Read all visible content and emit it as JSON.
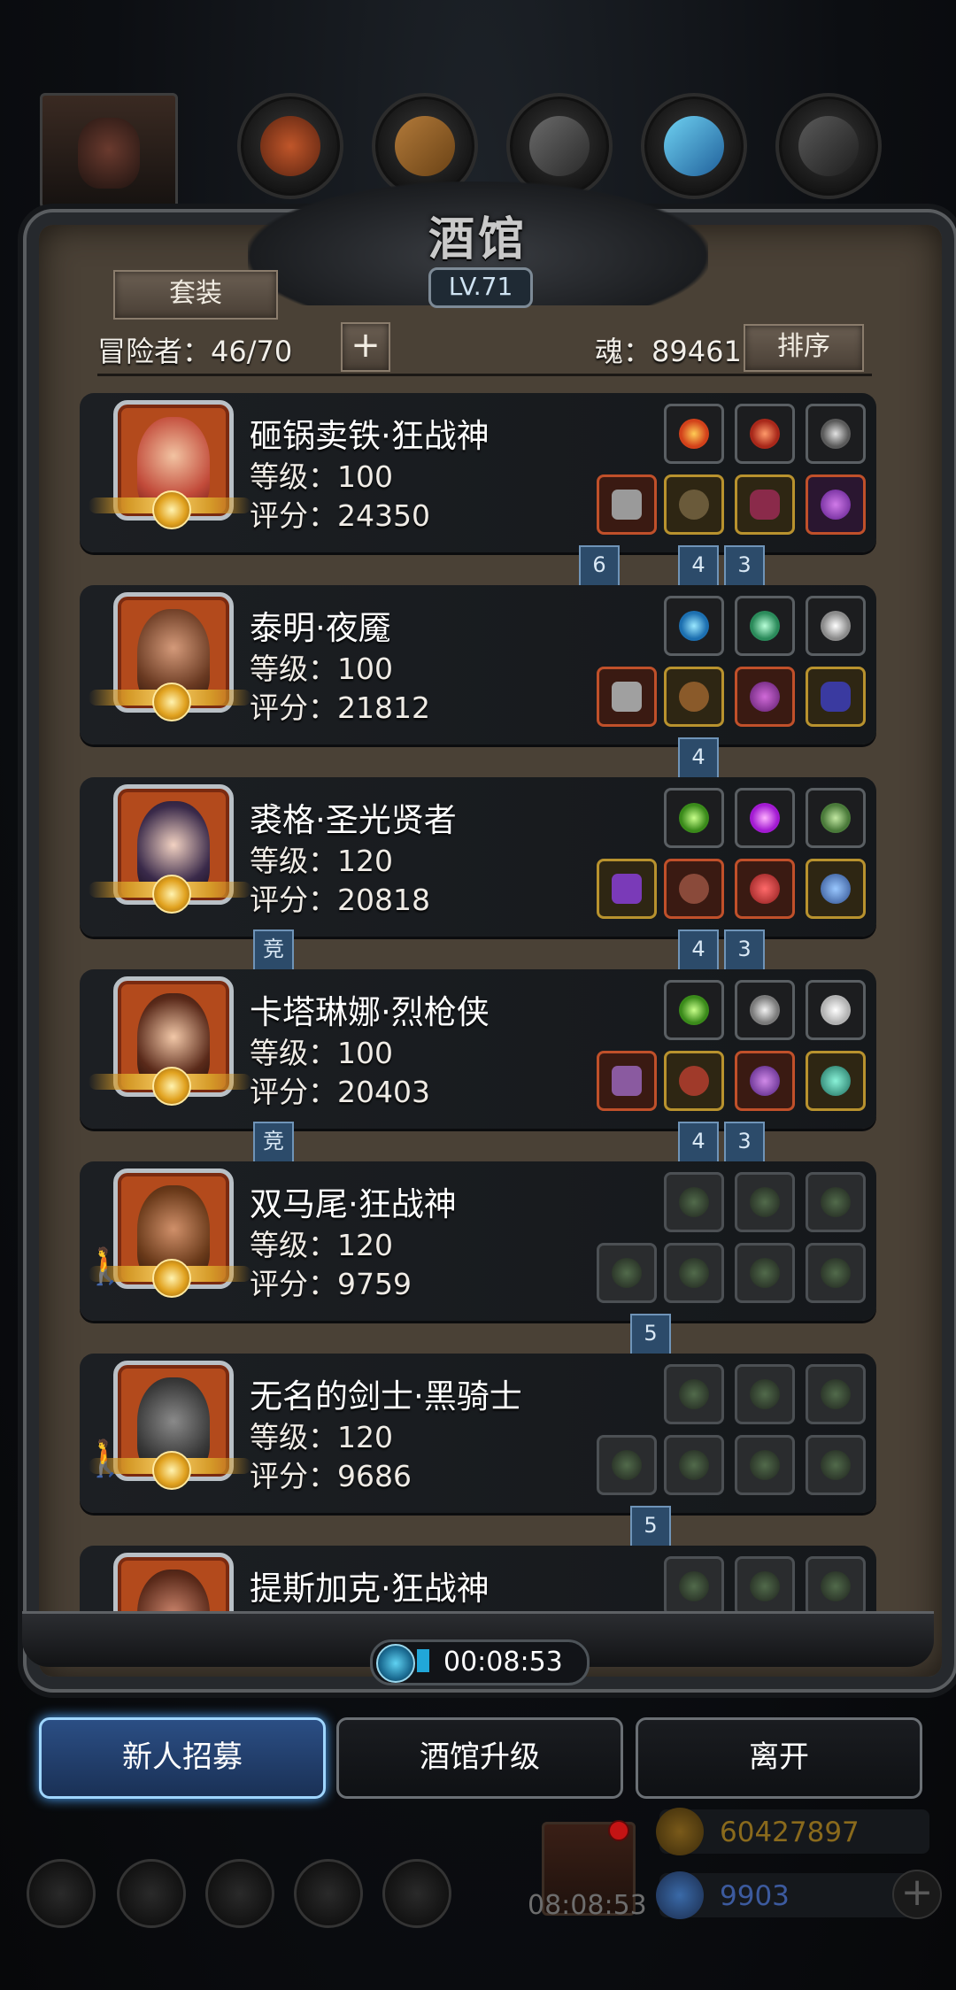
{
  "header": {
    "title": "酒馆",
    "level": "LV.71",
    "set_button": "套装",
    "adventurers_label": "冒险者：46/70",
    "add_button": "+",
    "soul_label": "魂：89461",
    "sort_button": "排序"
  },
  "heroes": [
    {
      "name": "砸锅卖铁·狂战神",
      "level": "等级：100",
      "score": "评分：24350",
      "ribbons": [
        "6",
        "4",
        "3"
      ]
    },
    {
      "name": "泰明·夜魇",
      "level": "等级：100",
      "score": "评分：21812",
      "ribbons": [
        "4"
      ]
    },
    {
      "name": "裘格·圣光贤者",
      "level": "等级：120",
      "score": "评分：20818",
      "ribbons": [
        "竞",
        "4",
        "3"
      ]
    },
    {
      "name": "卡塔琳娜·烈枪侠",
      "level": "等级：100",
      "score": "评分：20403",
      "ribbons": [
        "竞",
        "4",
        "3"
      ]
    },
    {
      "name": "双马尾·狂战神",
      "level": "等级：120",
      "score": "评分：9759",
      "ribbons": [
        "5"
      ]
    },
    {
      "name": "无名的剑士·黑骑士",
      "level": "等级：120",
      "score": "评分：9686",
      "ribbons": [
        "5"
      ]
    },
    {
      "name": "提斯加克·狂战神",
      "level": "",
      "score": "",
      "ribbons": []
    }
  ],
  "timer": "00:08:53",
  "actions": {
    "recruit": "新人招募",
    "upgrade": "酒馆升级",
    "leave": "离开"
  },
  "hud": {
    "gift_timer": "08:08:53",
    "gold": "60427897",
    "diamonds": "9903",
    "plus": "+"
  },
  "colors": {
    "gold_text": "#8a6a1c",
    "diamond_text": "#3c5a9e",
    "recruit_glow": "#4fa8ff"
  }
}
